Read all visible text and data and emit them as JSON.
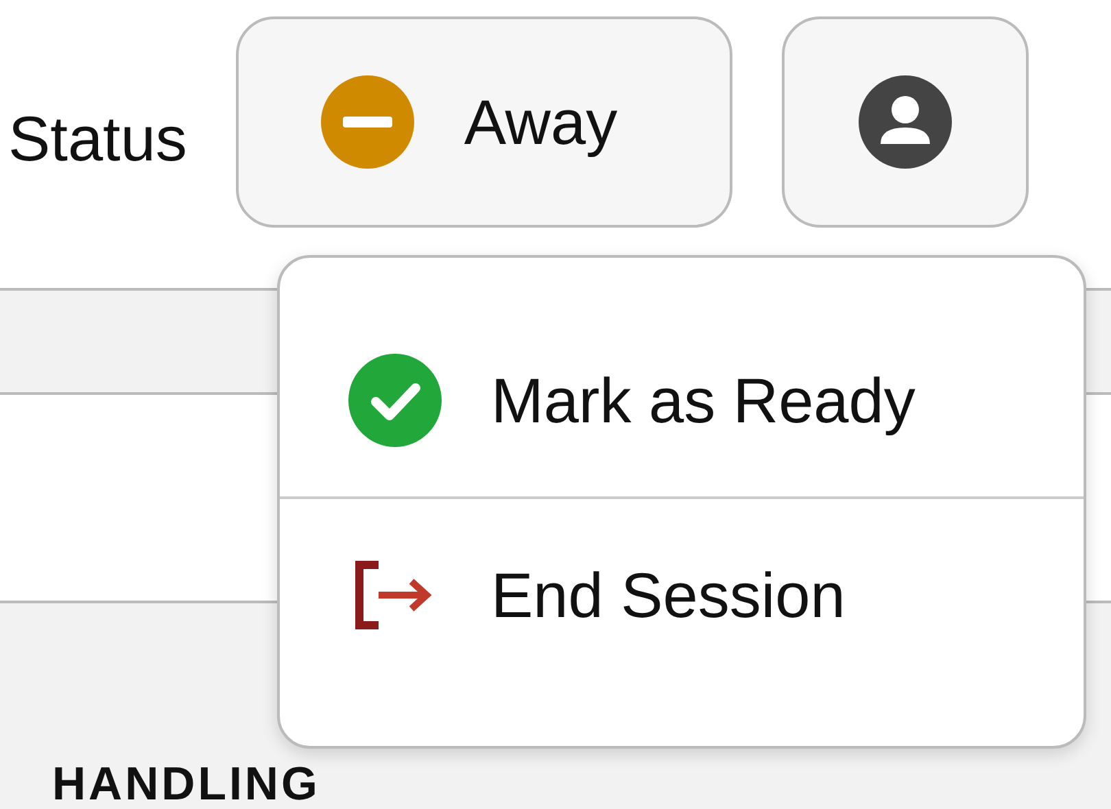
{
  "header": {
    "status_label": "Status",
    "status_button": {
      "label": "Away",
      "color": "#d08a00"
    }
  },
  "status_menu": {
    "items": [
      {
        "label": "Mark as Ready",
        "kind": "ready"
      },
      {
        "label": "End Session",
        "kind": "end"
      }
    ]
  },
  "section": {
    "heading": "HANDLING"
  }
}
